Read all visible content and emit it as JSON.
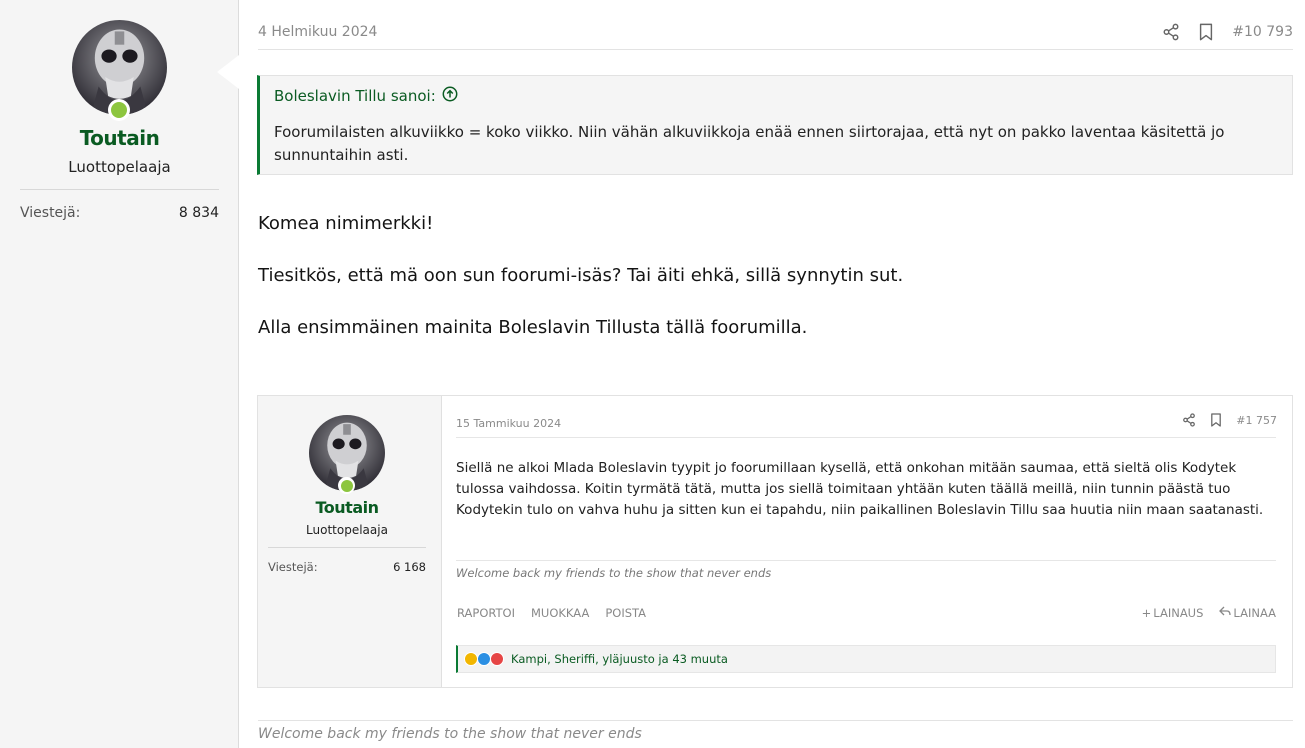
{
  "post": {
    "author": {
      "username": "Toutain",
      "title": "Luottopelaaja",
      "stats": {
        "label": "Viestejä:",
        "value": "8 834"
      }
    },
    "date": "4 Helmikuu 2024",
    "post_number": "#10 793",
    "quote": {
      "author_line": "Boleslavin Tillu sanoi:",
      "text": "Foorumilaisten alkuviikko = koko viikko. Niin vähän alkuviikkoja enää ennen siirtorajaa, että nyt on pakko laventaa käsitettä jo sunnuntaihin asti."
    },
    "message": {
      "line1": "Komea nimimerkki!",
      "line2": "Tiesitkös, että mä oon sun foorumi-isäs? Tai äiti ehkä, sillä synnytin sut.",
      "line3": "Alla ensimmäinen mainita Boleslavin Tillusta tällä foorumilla."
    },
    "signature": "Welcome back my friends to the show that never ends"
  },
  "embedded": {
    "author": {
      "username": "Toutain",
      "title": "Luottopelaaja",
      "stats": {
        "label": "Viestejä:",
        "value": "6 168"
      }
    },
    "date": "15 Tammikuu 2024",
    "post_number": "#1 757",
    "body": "Siellä ne alkoi Mlada Boleslavin tyypit jo foorumillaan kysellä, että onkohan mitään saumaa, että sieltä olis Kodytek tulossa vaihdossa. Koitin tyrmätä tätä, mutta jos siellä toimitaan yhtään kuten täällä meillä, niin tunnin päästä tuo Kodytekin tulo on vahva huhu ja sitten kun ei tapahdu, niin paikallinen Boleslavin Tillu saa huutia niin maan saatanasti.",
    "signature": "Welcome back my friends to the show that never ends",
    "actions_left": [
      "RAPORTOI",
      "MUOKKAA",
      "POISTA"
    ],
    "actions_right": [
      "LAINAUS",
      "LAINAA"
    ],
    "reactions": {
      "icons": [
        "laugh-reaction-icon",
        "like-reaction-icon",
        "love-reaction-icon"
      ],
      "colors": [
        "#f2b600",
        "#2b8fe3",
        "#e64545"
      ],
      "text": "Kampi, Sheriffi, yläjuusto ja 43 muuta"
    }
  },
  "colors": {
    "accent": "#0a5b22",
    "quote_border": "#0a7a34",
    "online": "#8dc63f"
  }
}
